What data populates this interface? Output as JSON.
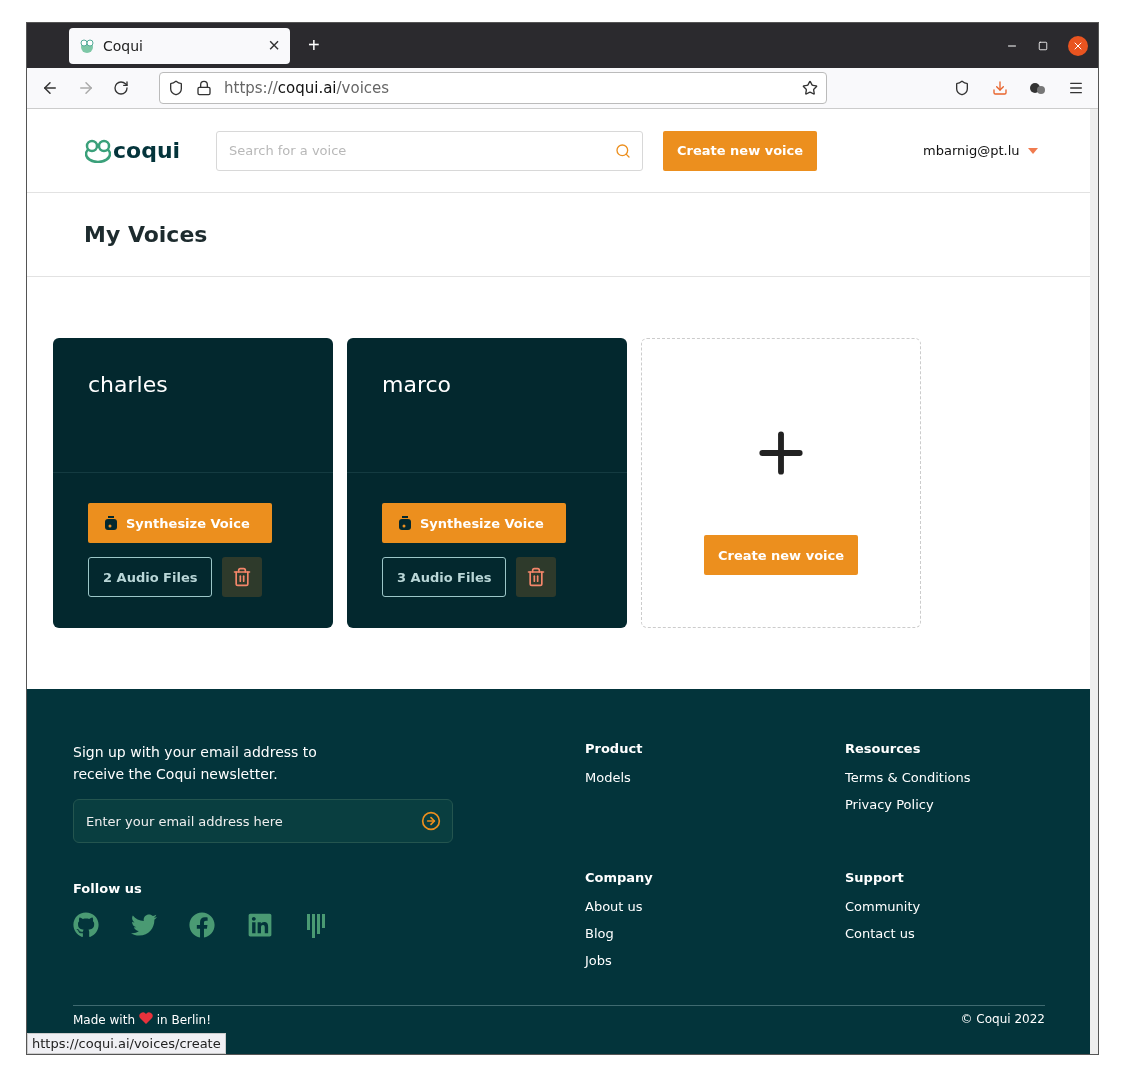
{
  "browser": {
    "tab": {
      "title": "Coqui",
      "close": "×"
    },
    "new_tab": "+",
    "url": {
      "scheme": "https://",
      "domain": "coqui.ai",
      "path": "/voices"
    },
    "status_link": "https://coqui.ai/voices/create"
  },
  "header": {
    "logo": "coqui",
    "search": {
      "placeholder": "Search for a voice"
    },
    "create_button": "Create new voice",
    "user": "mbarnig@pt.lu"
  },
  "page_title": "My Voices",
  "voices": [
    {
      "name": "charles",
      "synthesize": "Synthesize Voice",
      "files": "2 Audio Files"
    },
    {
      "name": "marco",
      "synthesize": "Synthesize Voice",
      "files": "3 Audio Files"
    }
  ],
  "new_voice_card": {
    "button": "Create new voice"
  },
  "footer": {
    "newsletter": "Sign up with your email address to receive the Coqui newsletter.",
    "email": {
      "placeholder": "Enter your email address here"
    },
    "follow": "Follow us",
    "columns": [
      {
        "title": "Product",
        "links": [
          "Models"
        ]
      },
      {
        "title": "Resources",
        "links": [
          "Terms & Conditions",
          "Privacy Policy"
        ]
      },
      {
        "title": "Company",
        "links": [
          "About us",
          "Blog",
          "Jobs"
        ]
      },
      {
        "title": "Support",
        "links": [
          "Community",
          "Contact us"
        ]
      }
    ],
    "made_with": [
      "Made with",
      "in Berlin!"
    ],
    "copyright": "© Coqui 2022"
  }
}
